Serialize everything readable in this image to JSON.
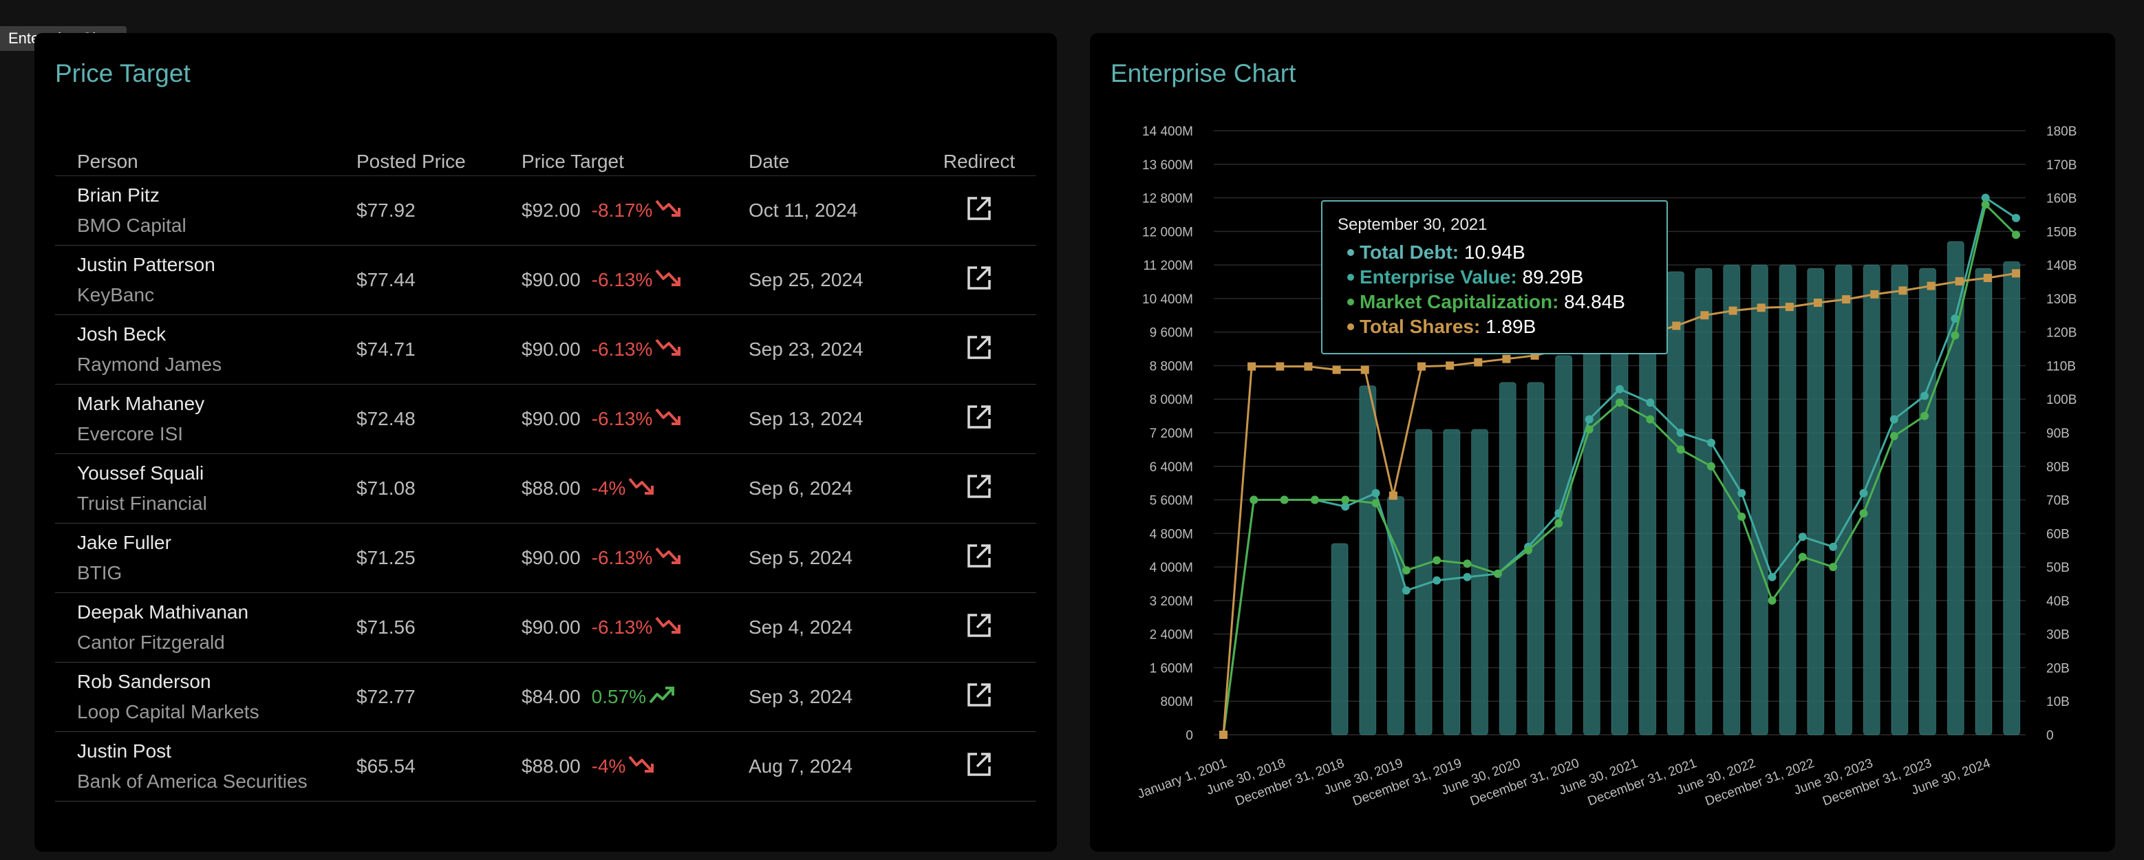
{
  "window_tag": "Enterprise Chart",
  "price_target": {
    "title": "Price Target",
    "columns": {
      "person": "Person",
      "posted": "Posted Price",
      "target": "Price Target",
      "date": "Date",
      "redirect": "Redirect"
    },
    "rows": [
      {
        "name": "Brian Pitz",
        "firm": "BMO Capital",
        "posted": "$77.92",
        "target": "$92.00",
        "pct": "-8.17%",
        "direction": "down",
        "date": "Oct 11, 2024"
      },
      {
        "name": "Justin Patterson",
        "firm": "KeyBanc",
        "posted": "$77.44",
        "target": "$90.00",
        "pct": "-6.13%",
        "direction": "down",
        "date": "Sep 25, 2024"
      },
      {
        "name": "Josh Beck",
        "firm": "Raymond James",
        "posted": "$74.71",
        "target": "$90.00",
        "pct": "-6.13%",
        "direction": "down",
        "date": "Sep 23, 2024"
      },
      {
        "name": "Mark Mahaney",
        "firm": "Evercore ISI",
        "posted": "$72.48",
        "target": "$90.00",
        "pct": "-6.13%",
        "direction": "down",
        "date": "Sep 13, 2024"
      },
      {
        "name": "Youssef Squali",
        "firm": "Truist Financial",
        "posted": "$71.08",
        "target": "$88.00",
        "pct": "-4%",
        "direction": "down",
        "date": "Sep 6, 2024"
      },
      {
        "name": "Jake Fuller",
        "firm": "BTIG",
        "posted": "$71.25",
        "target": "$90.00",
        "pct": "-6.13%",
        "direction": "down",
        "date": "Sep 5, 2024"
      },
      {
        "name": "Deepak Mathivanan",
        "firm": "Cantor Fitzgerald",
        "posted": "$71.56",
        "target": "$90.00",
        "pct": "-6.13%",
        "direction": "down",
        "date": "Sep 4, 2024"
      },
      {
        "name": "Rob Sanderson",
        "firm": "Loop Capital Markets",
        "posted": "$72.77",
        "target": "$84.00",
        "pct": "0.57%",
        "direction": "up",
        "date": "Sep 3, 2024"
      },
      {
        "name": "Justin Post",
        "firm": "Bank of America Securities",
        "posted": "$65.54",
        "target": "$88.00",
        "pct": "-4%",
        "direction": "down",
        "date": "Aug 7, 2024"
      }
    ],
    "colors": {
      "negative": "#e0504a",
      "positive": "#4caf50",
      "title": "#5fb3b3"
    },
    "icons": {
      "down": "trending-down-icon",
      "up": "trending-up-icon",
      "redirect": "external-link-icon"
    }
  },
  "enterprise_chart": {
    "title": "Enterprise Chart",
    "tooltip": {
      "date": "September 30, 2021",
      "lines": [
        {
          "label": "Total Debt:",
          "value": "10.94B",
          "color": "#5fb3b3"
        },
        {
          "label": "Enterprise Value:",
          "value": "89.29B",
          "color": "#3fa99e"
        },
        {
          "label": "Market Capitalization:",
          "value": "84.84B",
          "color": "#4caf50"
        },
        {
          "label": "Total Shares:",
          "value": "1.89B",
          "color": "#c8964a"
        }
      ]
    }
  },
  "chart_data": {
    "type": "bar",
    "title": "Enterprise Chart",
    "x_tick_labels": [
      "January 1, 2001",
      "June 30, 2018",
      "December 31, 2018",
      "June 30, 2019",
      "December 31, 2019",
      "June 30, 2020",
      "December 31, 2020",
      "June 30, 2021",
      "December 31, 2021",
      "June 30, 2022",
      "December 31, 2022",
      "June 30, 2023",
      "December 31, 2023",
      "June 30, 2024"
    ],
    "y_left_ticks": [
      "0",
      "800M",
      "1 600M",
      "2 400M",
      "3 200M",
      "4 000M",
      "4 800M",
      "5 600M",
      "6 400M",
      "7 200M",
      "8 000M",
      "8 800M",
      "9 600M",
      "10 400M",
      "11 200M",
      "12 000M",
      "12 800M",
      "13 600M",
      "14 400M"
    ],
    "y_right_ticks": [
      "0",
      "10B",
      "20B",
      "30B",
      "40B",
      "50B",
      "60B",
      "70B",
      "80B",
      "90B",
      "100B",
      "110B",
      "120B",
      "130B",
      "140B",
      "150B",
      "160B",
      "170B",
      "180B"
    ],
    "y_left_range": [
      0,
      14400
    ],
    "y_right_range": [
      0,
      180
    ],
    "grid": true,
    "series": [
      {
        "name": "Total Debt",
        "kind": "bar",
        "axis": "right",
        "color": "#5fb3b3",
        "values": [
          0,
          0,
          0,
          0,
          57,
          104,
          71,
          91,
          91,
          91,
          105,
          105,
          113,
          116,
          118,
          124,
          138,
          139,
          140,
          140,
          140,
          139,
          140,
          140,
          140,
          139,
          147,
          139,
          141
        ]
      },
      {
        "name": "Enterprise Value",
        "kind": "line",
        "axis": "right",
        "color": "#3fa99e",
        "values": [
          0,
          70,
          70,
          70,
          68,
          72,
          43,
          46,
          47,
          48,
          56,
          66,
          94,
          103,
          99,
          90,
          87,
          72,
          47,
          59,
          56,
          72,
          94,
          101,
          124,
          160,
          154
        ]
      },
      {
        "name": "Market Capitalization",
        "kind": "line",
        "axis": "right",
        "color": "#4caf50",
        "values": [
          0,
          70,
          70,
          70,
          70,
          69,
          49,
          52,
          51,
          48,
          55,
          63,
          91,
          99,
          94,
          85,
          80,
          65,
          40,
          53,
          50,
          66,
          89,
          95,
          119,
          158,
          149
        ]
      },
      {
        "name": "Total Shares",
        "kind": "line",
        "axis": "left",
        "color": "#c8964a",
        "values": [
          0,
          8780,
          8780,
          8780,
          8700,
          8700,
          5700,
          8780,
          8800,
          8880,
          8960,
          9040,
          9200,
          9400,
          9500,
          9560,
          9750,
          10000,
          10110,
          10180,
          10200,
          10300,
          10380,
          10500,
          10590,
          10700,
          10810,
          10890,
          11000
        ]
      }
    ]
  }
}
